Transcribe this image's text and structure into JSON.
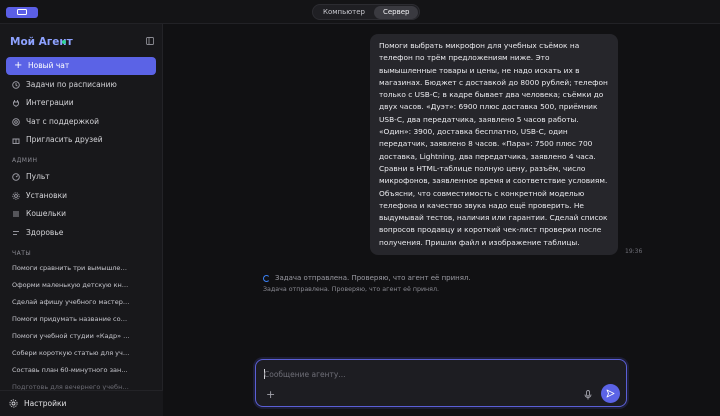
{
  "topbar": {
    "tabs": [
      {
        "label": "Компьютер",
        "active": false
      },
      {
        "label": "Сервер",
        "active": true
      }
    ]
  },
  "sidebar": {
    "brand": "Мой Агент",
    "new_chat_label": "Новый чат",
    "nav": [
      {
        "label": "Задачи по расписанию",
        "icon": "clock-icon"
      },
      {
        "label": "Интеграции",
        "icon": "plug-icon"
      },
      {
        "label": "Чат с поддержкой",
        "icon": "support-icon"
      },
      {
        "label": "Пригласить друзей",
        "icon": "gift-icon"
      }
    ],
    "admin_label": "АДМИН",
    "admin_items": [
      {
        "label": "Пульт",
        "icon": "dashboard-icon"
      },
      {
        "label": "Установки",
        "icon": "gear-icon"
      },
      {
        "label": "Кошельки",
        "icon": "wallet-icon"
      },
      {
        "label": "Здоровье",
        "icon": "heart-icon"
      }
    ],
    "chats_label": "ЧАТЫ",
    "chats": [
      "Помоги сравнить три вымышленн...",
      "Оформи маленькую детскую книж...",
      "Сделай афишу учебного мастер-кл...",
      "Помоги придумать название сооб...",
      "Помоги учебной студии «Кадр» пр...",
      "Собери короткую статью для учеб...",
      "Составь план 60-минутного заняти...",
      "Подготовь для вечернего учебного..."
    ],
    "settings_label": "Настройки"
  },
  "chat": {
    "user_message": "Помоги выбрать микрофон для учебных съёмок на телефон по трём предложениям ниже. Это вымышленные товары и цены, не надо искать их в магазинах. Бюджет с доставкой до 8000 рублей; телефон только с USB-C; в кадре бывает два человека; съёмки до двух часов. «Дуэт»: 6900 плюс доставка 500, приёмник USB-C, два передатчика, заявлено 5 часов работы. «Один»: 3900, доставка бесплатно, USB-C, один передатчик, заявлено 8 часов. «Пара»: 7500 плюс 700 доставка, Lightning, два передатчика, заявлено 4 часа. Сравни в HTML-таблице полную цену, разъём, число микрофонов, заявленное время и соответствие условиям. Объясни, что совместимость с конкретной моделью телефона и качество звука надо ещё проверить. Не выдумывай тестов, наличия или гарантии. Сделай список вопросов продавцу и короткий чек-лист проверки после получения. Пришли файл и изображение таблицы.",
    "time": "19:36",
    "status": "Задача отправлена. Проверяю, что агент её принял.",
    "status_sub": "Задача отправлена. Проверяю, что агент её принял.",
    "composer_placeholder": "Сообщение агенту..."
  },
  "colors": {
    "accent": "#5b63e6",
    "brand": "#8ea2ff",
    "online": "#34d399"
  }
}
